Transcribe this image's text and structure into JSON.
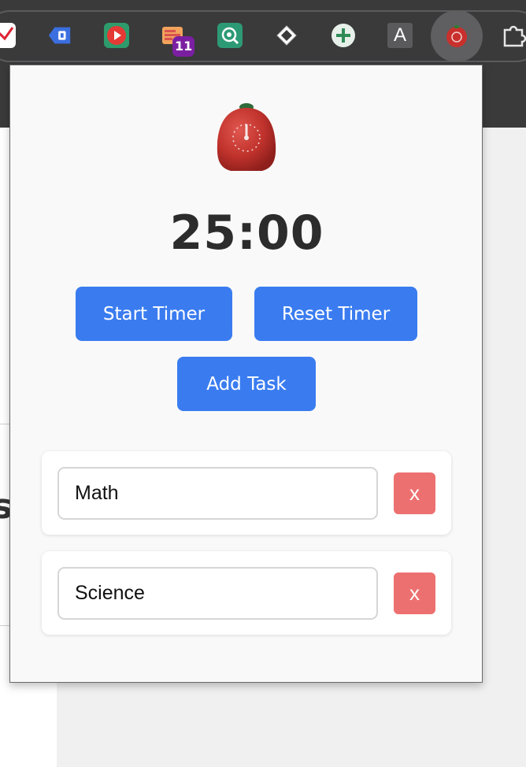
{
  "toolbar": {
    "extensions": [
      {
        "icon": "chart-extension-icon"
      },
      {
        "icon": "tag-extension-icon"
      },
      {
        "icon": "youtube-play-extension-icon"
      },
      {
        "icon": "tabs-extension-icon",
        "badge": "11"
      },
      {
        "icon": "chatgpt-search-extension-icon"
      },
      {
        "icon": "diamond-extension-icon"
      },
      {
        "icon": "plus-extension-icon"
      },
      {
        "icon": "font-a-extension-icon",
        "label": "A"
      },
      {
        "icon": "tomato-timer-extension-icon",
        "active": true
      },
      {
        "icon": "puzzle-extensions-icon"
      }
    ]
  },
  "popup": {
    "logo": "tomato-timer-icon",
    "timer": "25:00",
    "buttons": {
      "start": "Start Timer",
      "reset": "Reset Timer",
      "add": "Add Task"
    },
    "tasks": [
      {
        "name": "Math",
        "delete_label": "x"
      },
      {
        "name": "Science",
        "delete_label": "x"
      }
    ]
  },
  "background_page": {
    "fragment_s": "s"
  },
  "colors": {
    "accent": "#3a7cf0",
    "delete": "#ed7070",
    "timer_text": "#2c2c2c",
    "badge": "#7b1fa2"
  }
}
